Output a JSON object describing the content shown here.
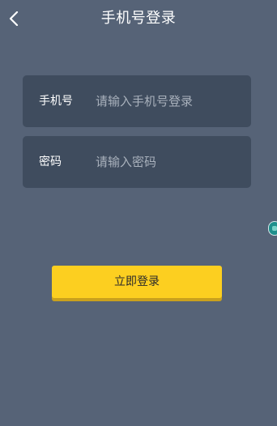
{
  "header": {
    "title": "手机号登录",
    "back_icon": "chevron-left-icon"
  },
  "form": {
    "phone": {
      "label": "手机号",
      "placeholder": "请输入手机号登录",
      "value": ""
    },
    "password": {
      "label": "密码",
      "placeholder": "请输入密码",
      "value": ""
    }
  },
  "actions": {
    "login_label": "立即登录"
  },
  "colors": {
    "background": "#566377",
    "field_background": "#3f4c5e",
    "accent_button": "#fccf20",
    "placeholder_text": "#a9b1bc",
    "handle": "#1f8f8c"
  }
}
